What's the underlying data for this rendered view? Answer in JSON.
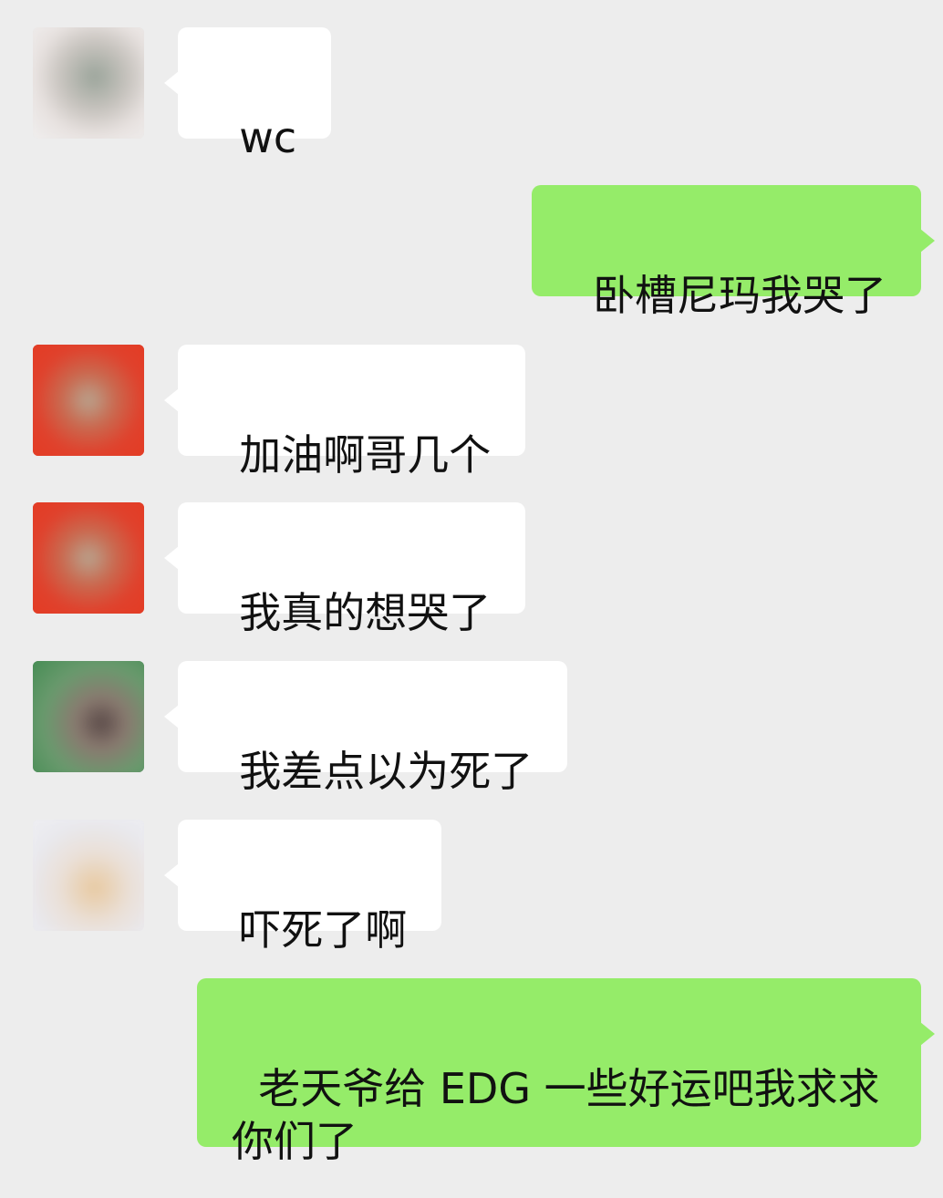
{
  "colors": {
    "background": "#ededed",
    "incoming_bubble": "#ffffff",
    "outgoing_bubble": "#95ec69",
    "text": "#111111"
  },
  "messages": [
    {
      "side": "left",
      "avatar": "blurred-avatar-1",
      "text": "wc"
    },
    {
      "side": "right",
      "text": "卧槽尼玛我哭了"
    },
    {
      "side": "left",
      "avatar": "blurred-avatar-2",
      "text": "加油啊哥几个"
    },
    {
      "side": "left",
      "avatar": "blurred-avatar-3",
      "text": "我真的想哭了"
    },
    {
      "side": "left",
      "avatar": "blurred-avatar-4",
      "text": "我差点以为死了"
    },
    {
      "side": "left",
      "avatar": "blurred-avatar-5",
      "text": "吓死了啊"
    },
    {
      "side": "right",
      "text": "老天爷给 EDG 一些好运吧我求求你们了"
    }
  ]
}
